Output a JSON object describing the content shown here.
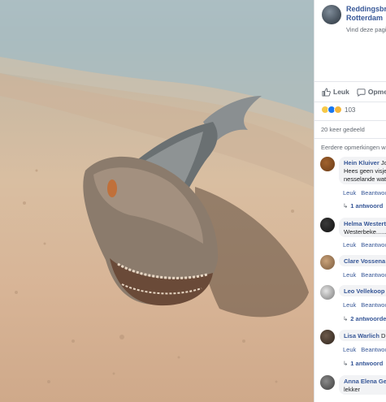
{
  "page": {
    "name_line1": "Reddingsbri",
    "name_line2": "Rotterdam",
    "subtitle": "Vind deze pagi"
  },
  "actions": {
    "like_label": "Leuk",
    "comment_label": "Opmerk"
  },
  "reactions": {
    "count": "103",
    "types": [
      "wow-icon",
      "like-icon",
      "haha-icon"
    ]
  },
  "shares_text": "20 keer gedeeld",
  "earlier_comments_text": "Eerdere opmerkingen we",
  "comments": [
    {
      "author": "Hein Kluiver",
      "text_after_author": " Jo",
      "line2": "Hees geen visje",
      "line3": "nesselande wat",
      "like_label": "Leuk",
      "reply_label": "Beantwoo",
      "replies": "1 antwoord"
    },
    {
      "author": "Helma Westert",
      "line2": "Westerbeke......",
      "like_label": "Leuk",
      "reply_label": "Beantwoo"
    },
    {
      "author": "Clare Vossena",
      "like_label": "Leuk",
      "reply_label": "Beantwoo"
    },
    {
      "author": "Leo Vellekoop",
      "like_label": "Leuk",
      "reply_label": "Beantwoo",
      "replies": "2 antwoorde"
    },
    {
      "author": "Lisa Warlich",
      "text_after_author": " D",
      "like_label": "Leuk",
      "reply_label": "Beantwoo",
      "replies": "1 antwoord"
    },
    {
      "author": "Anna Elena Ge",
      "line2": "lekker"
    }
  ],
  "colors": {
    "link_blue": "#385898",
    "meta_gray": "#606770",
    "bubble_bg": "#f2f3f5"
  }
}
